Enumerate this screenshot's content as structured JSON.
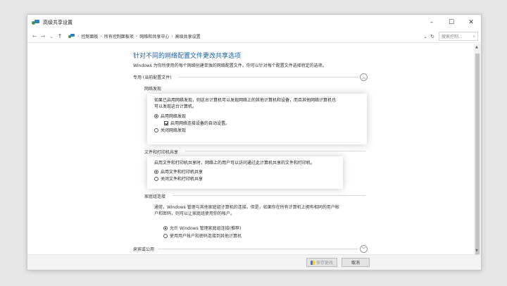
{
  "window": {
    "title": "高级共享设置",
    "controls": {
      "minimize": "–",
      "maximize": "☐",
      "close": "✕"
    }
  },
  "addressbar": {
    "back": "←",
    "forward": "→",
    "recent": "⌄",
    "up": "↑",
    "breadcrumbs": [
      "控制面板",
      "所有控制面板项",
      "网络和共享中心",
      "高级共享设置"
    ],
    "separator": "›",
    "dropdown": "⌄",
    "refresh": "↻",
    "search_placeholder": "搜索控制...",
    "search_icon": "⌕"
  },
  "main": {
    "heading": "针对不同的网络配置文件更改共享选项",
    "intro": "Windows 为你所使用的每个网络创建单独的网络配置文件。你可以针对每个配置文件选择特定的选项。",
    "profile_private": "专用 (当前配置文件)",
    "collapse_up": "︿",
    "collapse_down": "﹀",
    "discovery": {
      "title": "网络发现",
      "desc_line1": "如果已启用网络发现，则这台计算机可以发现网络上的其他计算机和设备，而且其他网络计算机也",
      "desc_line2": "可以发现这台计算机。",
      "opt_on": "启用网络发现",
      "opt_auto": "启用网络连接设备的自动设置。",
      "opt_off": "关闭网络发现"
    },
    "filesharing": {
      "title": "文件和打印机共享",
      "desc": "启用文件和打印机共享时，网络上的用户可以访问通过此计算机共享的文件和打印机。",
      "opt_on": "启用文件和打印机共享",
      "opt_off": "关闭文件和打印机共享"
    },
    "homegroup": {
      "title": "家庭组连接",
      "desc_line1": "通常，Windows 管理与其他家庭组计算机的连接。但是，如果你在所有计算机上拥有相同的用户帐",
      "desc_line2": "户和密码，则可以让家庭组使用你的帐户。",
      "opt_allow": "允许 Windows 管理家庭组连接(推荐)",
      "opt_user": "使用用户帐户和密码连接到其他计算机"
    },
    "profile_guest": "来宾或公用"
  },
  "footer": {
    "save_label": "保存更改",
    "cancel_label": "取消"
  }
}
